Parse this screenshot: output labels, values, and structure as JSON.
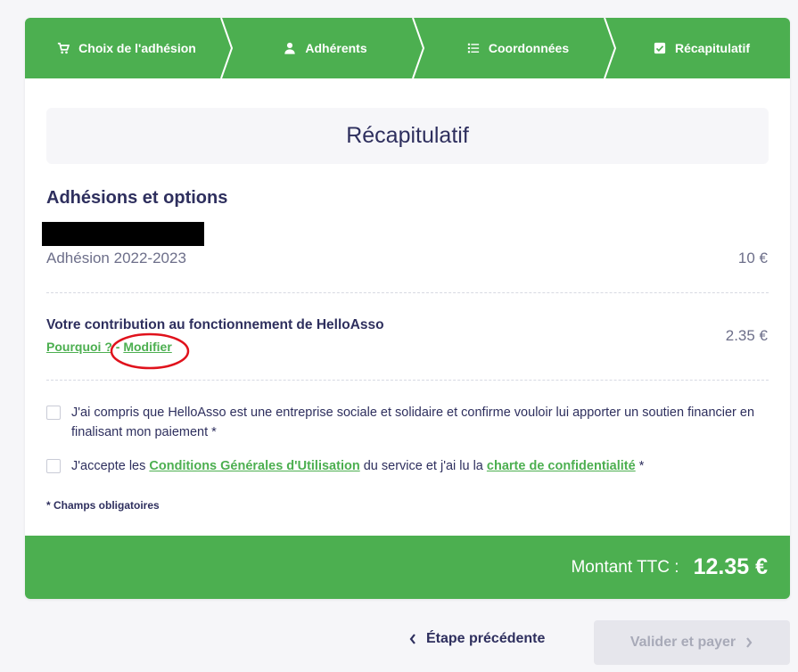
{
  "steps": [
    {
      "label": "Choix de l'adhésion",
      "icon": "cart-icon"
    },
    {
      "label": "Adhérents",
      "icon": "user-icon"
    },
    {
      "label": "Coordonnées",
      "icon": "list-icon"
    },
    {
      "label": "Récapitulatif",
      "icon": "checkbox-icon"
    }
  ],
  "title": "Récapitulatif",
  "section_title": "Adhésions et options",
  "membership": {
    "label": "Adhésion 2022-2023",
    "price": "10 €"
  },
  "contribution": {
    "label": "Votre contribution au fonctionnement de HelloAsso",
    "price": "2.35 €",
    "why_link": "Pourquoi ?",
    "separator": " - ",
    "modify_link": "Modifier"
  },
  "consent1": {
    "text": "J'ai compris que HelloAsso est une entreprise sociale et solidaire et confirme vouloir lui apporter un soutien financier en finalisant mon paiement *"
  },
  "consent2": {
    "prefix": "J'accepte les ",
    "cgu_link": "Conditions Générales d'Utilisation",
    "middle": " du service et j'ai lu la ",
    "privacy_link": "charte de confidentialité",
    "suffix": " *"
  },
  "required_note": "* Champs obligatoires",
  "total": {
    "label": "Montant TTC :",
    "value": "12.35 €"
  },
  "actions": {
    "prev": "Étape précédente",
    "pay": "Valider et payer"
  },
  "colors": {
    "accent": "#4caf50",
    "text": "#2e2f5e",
    "annotation": "#e0121c"
  }
}
